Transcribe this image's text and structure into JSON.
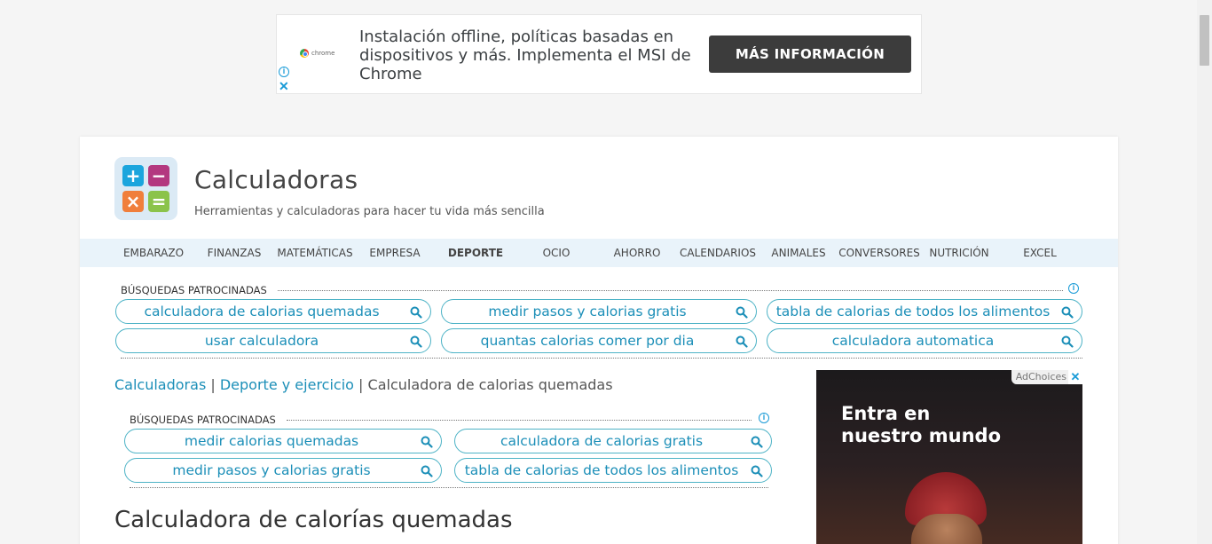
{
  "top_ad": {
    "brand_word": "chrome",
    "text": "Instalación offline, políticas basadas en dispositivos y más. Implementa el MSI de Chrome",
    "button": "MÁS INFORMACIÓN",
    "info_icon": "i",
    "close_icon": "✕"
  },
  "site": {
    "title": "Calculadoras",
    "subtitle": "Herramientas y calculadoras para hacer tu vida más sencilla",
    "logo_symbols": [
      "+",
      "−",
      "×",
      "="
    ],
    "colors": {
      "plus": "#1ba5dd",
      "minus": "#b3387f",
      "times": "#f07f3c",
      "equals": "#8bc34a"
    }
  },
  "nav": {
    "items": [
      "EMBARAZO",
      "FINANZAS",
      "MATEMÁTICAS",
      "EMPRESA",
      "DEPORTE",
      "OCIO",
      "AHORRO",
      "CALENDARIOS",
      "ANIMALES",
      "CONVERSORES",
      "NUTRICIÓN",
      "EXCEL"
    ],
    "active": "DEPORTE"
  },
  "sponsored_top": {
    "heading": "BÚSQUEDAS PATROCINADAS",
    "info_icon": "i",
    "pills": [
      "calculadora de calorias quemadas",
      "medir pasos y calorias gratis",
      "tabla de calorias de todos los alimentos",
      "usar calculadora",
      "quantas calorias comer por dia",
      "calculadora automatica"
    ]
  },
  "breadcrumb": {
    "level1": "Calculadoras",
    "level2": "Deporte y ejercicio",
    "current": "Calculadora de calorias quemadas",
    "separator": "|"
  },
  "sponsored_inner": {
    "heading": "BÚSQUEDAS PATROCINADAS",
    "info_icon": "i",
    "pills": [
      "medir calorias quemadas",
      "calculadora de calorias gratis",
      "medir pasos y calorias gratis",
      "tabla de calorias de todos los alimentos"
    ]
  },
  "page_title": "Calculadora de calorías quemadas",
  "side_ad": {
    "headline_line1": "Entra en",
    "headline_line2": "nuestro mundo",
    "adchoices": "AdChoices",
    "close_icon": "✕"
  },
  "colors": {
    "accent": "#1c8fb8",
    "pill_border": "#4db3c6",
    "nav_bg": "#e9f3fa"
  }
}
